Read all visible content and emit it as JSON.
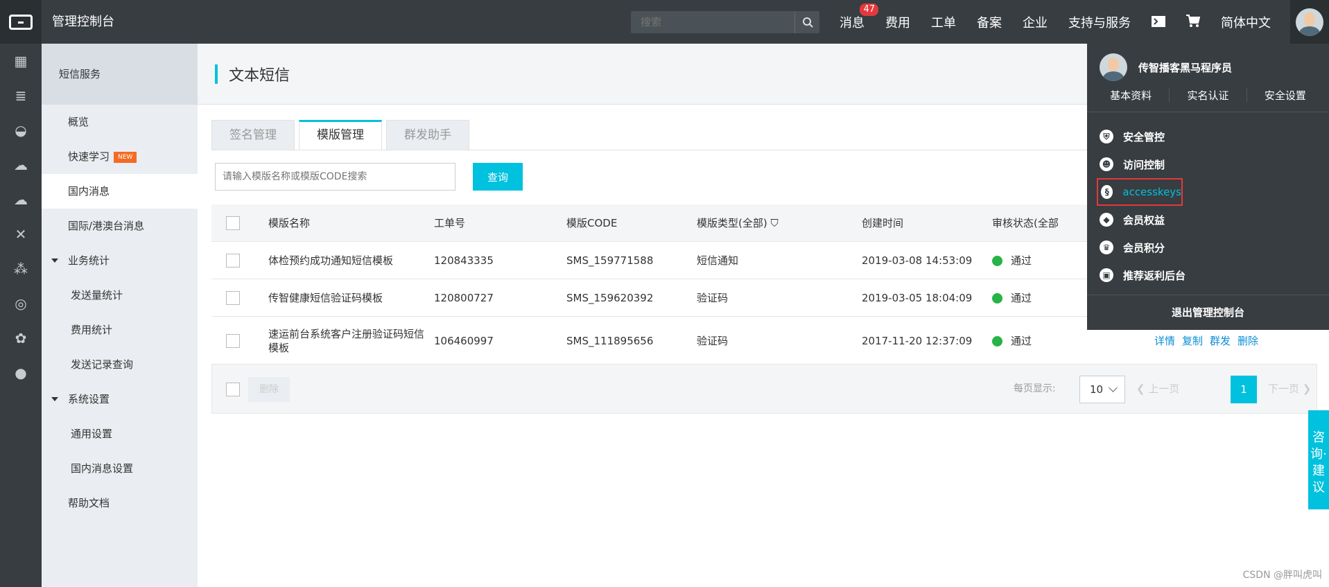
{
  "topbar": {
    "console_title": "管理控制台",
    "search_placeholder": "搜索",
    "nav": [
      "消息",
      "费用",
      "工单",
      "备案",
      "企业",
      "支持与服务"
    ],
    "message_badge": "47",
    "language": "简体中文"
  },
  "sidebar": {
    "header": "短信服务",
    "items": {
      "overview": "概览",
      "quick_learn": "快速学习",
      "new_badge": "NEW",
      "domestic": "国内消息",
      "intl": "国际/港澳台消息",
      "biz_stats": "业务统计",
      "send_stats": "发送量统计",
      "fee_stats": "费用统计",
      "send_records": "发送记录查询",
      "sys_settings": "系统设置",
      "general_settings": "通用设置",
      "domestic_settings": "国内消息设置",
      "help": "帮助文档"
    }
  },
  "main": {
    "title": "文本短信",
    "tabs": [
      "签名管理",
      "模版管理",
      "群发助手"
    ],
    "search_placeholder": "请输入模版名称或模版CODE搜索",
    "query_button": "查询",
    "columns": [
      "模版名称",
      "工单号",
      "模版CODE",
      "模版类型(全部)",
      "创建时间",
      "审核状态(全部"
    ],
    "rows": [
      {
        "name": "体检预约成功通知短信模板",
        "ticket": "120843335",
        "code": "SMS_159771588",
        "type": "短信通知",
        "created": "2019-03-08 14:53:09",
        "status": "通过"
      },
      {
        "name": "传智健康短信验证码模板",
        "ticket": "120800727",
        "code": "SMS_159620392",
        "type": "验证码",
        "created": "2019-03-05 18:04:09",
        "status": "通过"
      },
      {
        "name": "速运前台系统客户注册验证码短信模板",
        "ticket": "106460997",
        "code": "SMS_111895656",
        "type": "验证码",
        "created": "2017-11-20 12:37:09",
        "status": "通过"
      }
    ],
    "ops": [
      "详情",
      "复制",
      "群发",
      "删除"
    ],
    "footer": {
      "delete": "删除",
      "per_page_label": "每页显示:",
      "per_page": "10",
      "prev": "上一页",
      "page": "1",
      "next": "下一页"
    }
  },
  "dropdown": {
    "username": "传智播客黑马程序员",
    "links": [
      "基本资料",
      "实名认证",
      "安全设置"
    ],
    "menu": [
      "安全管控",
      "访问控制",
      "accesskeys",
      "会员权益",
      "会员积分",
      "推荐返利后台"
    ],
    "logout": "退出管理控制台"
  },
  "consult": "咨询·建议",
  "watermark": "CSDN @胖叫虎叫",
  "colors": {
    "accent": "#00c1de",
    "topbar": "#373d41",
    "status_ok": "#27b345",
    "badge": "#e4393c"
  }
}
